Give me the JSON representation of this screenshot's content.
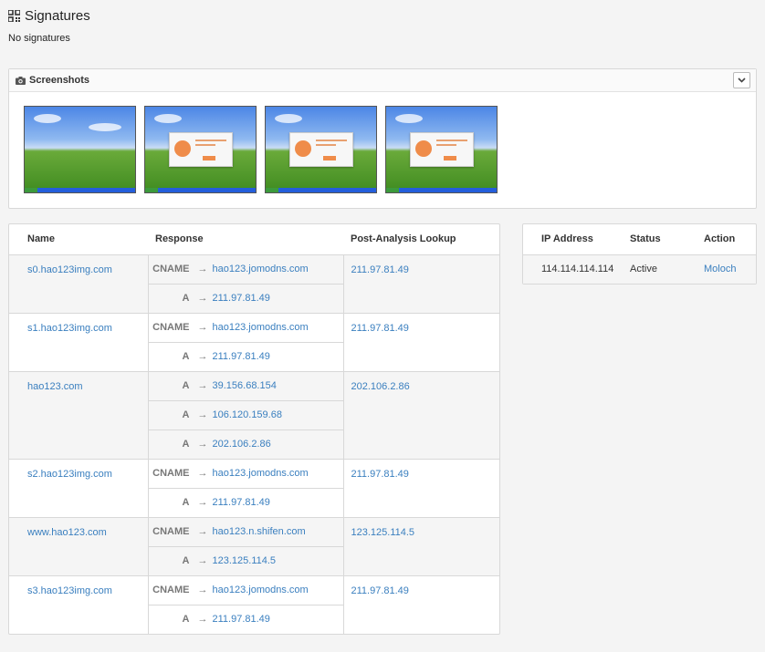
{
  "signatures": {
    "title": "Signatures",
    "empty_text": "No signatures",
    "icon": "qr-grid-icon"
  },
  "screenshots": {
    "title": "Screenshots",
    "icon": "camera-icon",
    "toggle_icon": "chevron-down-icon",
    "count": 4
  },
  "dns_table": {
    "headers": {
      "name": "Name",
      "response": "Response",
      "post": "Post-Analysis Lookup"
    },
    "groups": [
      {
        "name": "s0.hao123img.com",
        "post": "211.97.81.49",
        "responses": [
          {
            "type": "CNAME",
            "value": "hao123.jomodns.com"
          },
          {
            "type": "A",
            "value": "211.97.81.49"
          }
        ]
      },
      {
        "name": "s1.hao123img.com",
        "post": "211.97.81.49",
        "responses": [
          {
            "type": "CNAME",
            "value": "hao123.jomodns.com"
          },
          {
            "type": "A",
            "value": "211.97.81.49"
          }
        ]
      },
      {
        "name": "hao123.com",
        "post": "202.106.2.86",
        "responses": [
          {
            "type": "A",
            "value": "39.156.68.154"
          },
          {
            "type": "A",
            "value": "106.120.159.68"
          },
          {
            "type": "A",
            "value": "202.106.2.86"
          }
        ]
      },
      {
        "name": "s2.hao123img.com",
        "post": "211.97.81.49",
        "responses": [
          {
            "type": "CNAME",
            "value": "hao123.jomodns.com"
          },
          {
            "type": "A",
            "value": "211.97.81.49"
          }
        ]
      },
      {
        "name": "www.hao123.com",
        "post": "123.125.114.5",
        "responses": [
          {
            "type": "CNAME",
            "value": "hao123.n.shifen.com"
          },
          {
            "type": "A",
            "value": "123.125.114.5"
          }
        ]
      },
      {
        "name": "s3.hao123img.com",
        "post": "211.97.81.49",
        "responses": [
          {
            "type": "CNAME",
            "value": "hao123.jomodns.com"
          },
          {
            "type": "A",
            "value": "211.97.81.49"
          }
        ]
      }
    ]
  },
  "ip_table": {
    "headers": {
      "ip": "IP Address",
      "status": "Status",
      "action": "Action"
    },
    "rows": [
      {
        "ip": "114.114.114.114",
        "status": "Active",
        "action": "Moloch"
      }
    ]
  }
}
